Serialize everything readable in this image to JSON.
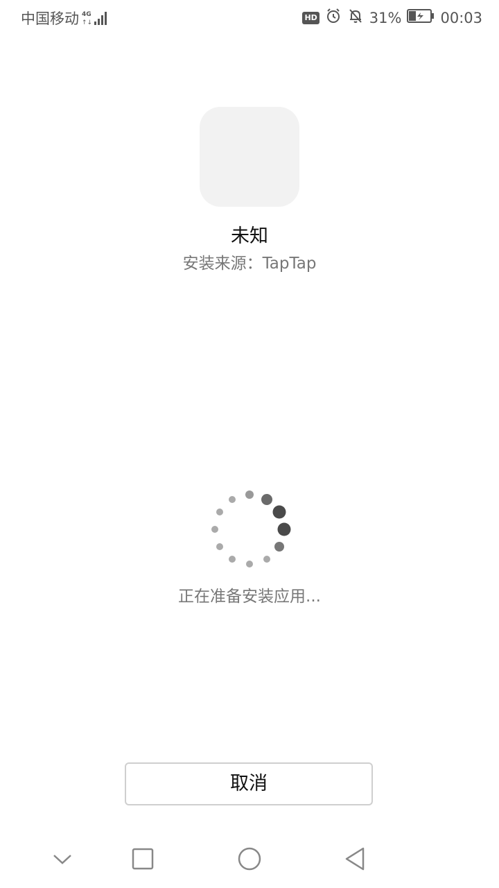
{
  "status_bar": {
    "carrier": "中国移动",
    "network_icon": "signal-4g-icon",
    "hd_label": "HD",
    "battery_percent": "31%",
    "time": "00:03"
  },
  "app": {
    "name": "未知",
    "source": "安装来源：TapTap"
  },
  "progress": {
    "message": "正在准备安装应用..."
  },
  "actions": {
    "cancel_label": "取消"
  },
  "nav": {
    "items": [
      "chevron-down-icon",
      "square-recents-icon",
      "circle-home-icon",
      "triangle-back-icon"
    ]
  },
  "colors": {
    "text_primary": "#111111",
    "text_secondary": "#777777",
    "icon_placeholder": "#f2f2f2",
    "button_border": "#cfcfcf",
    "spinner": "#555555"
  }
}
